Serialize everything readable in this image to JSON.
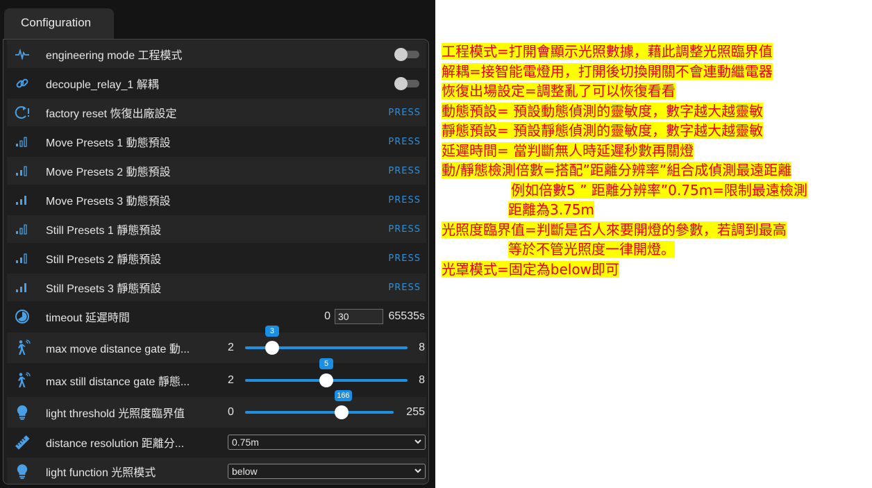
{
  "tab": {
    "label": "Configuration"
  },
  "rows": {
    "engineering": {
      "label": "engineering mode 工程模式",
      "state": "off"
    },
    "decouple": {
      "label": "decouple_relay_1 解耦",
      "state": "off"
    },
    "factory": {
      "label": "factory reset 恢復出廠設定",
      "action": "PRESS"
    },
    "move1": {
      "label": "Move Presets 1 動態預設",
      "action": "PRESS"
    },
    "move2": {
      "label": "Move Presets 2 動態預設",
      "action": "PRESS"
    },
    "move3": {
      "label": "Move Presets 3 動態預設",
      "action": "PRESS"
    },
    "still1": {
      "label": "Still Presets 1 靜態預設",
      "action": "PRESS"
    },
    "still2": {
      "label": "Still Presets 2 靜態預設",
      "action": "PRESS"
    },
    "still3": {
      "label": "Still Presets 3 靜態預設",
      "action": "PRESS"
    },
    "timeout": {
      "label": "timeout 延遲時間",
      "min": "0",
      "value": "30",
      "max": "65535s"
    },
    "maxmove": {
      "label": "max move distance gate 動...",
      "min": "2",
      "max": "8",
      "value": "3",
      "level": 3
    },
    "maxstill": {
      "label": "max still distance gate 靜態...",
      "min": "2",
      "max": "8",
      "value": "5",
      "level": 5
    },
    "light": {
      "label": "light threshold 光照度臨界值",
      "min": "0",
      "max": "255",
      "value": "166",
      "level": 166
    },
    "resolution": {
      "label": "distance resolution 距離分...",
      "selected": "0.75m"
    },
    "lightfn": {
      "label": "light function 光照模式",
      "selected": "below"
    }
  },
  "notes": [
    "工程模式=打開會顯示光照數據，藉此調整光照臨界值",
    "解耦=接智能電燈用，打開後切換開關不會連動繼電器",
    "恢復出場設定=調整亂了可以恢復看看",
    "動態預設= 預設動態偵測的靈敏度，數字越大越靈敏",
    "靜態預設= 預設靜態偵測的靈敏度，數字越大越靈敏",
    "延遲時間= 當判斷無人時延遲秒數再關燈",
    "動/靜態檢測倍數=搭配”距離分辨率”組合成偵測最遠距離",
    "例如倍數5 ” 距離分辨率”0.75m=限制最遠檢測",
    "距離為3.75m",
    "光照度臨界值=判斷是否人來要開燈的參數，若調到最高",
    "等於不管光照度一律開燈。",
    "光罩模式=固定為below即可"
  ],
  "colors": {
    "accent": "#1f8fe0",
    "note_text": "#e8000b",
    "note_highlight": "#ffff00"
  }
}
